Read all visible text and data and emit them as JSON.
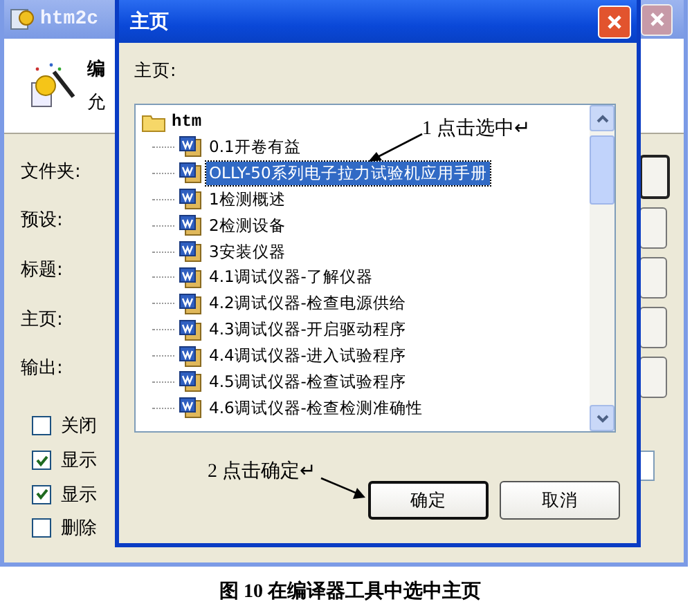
{
  "background_window": {
    "title": "htm2c",
    "header_title": "编",
    "header_subtitle": "允",
    "labels": [
      "文件夹:",
      "预设:",
      "标题:",
      "主页:",
      "输出:"
    ],
    "options": [
      {
        "label": "关闭",
        "checked": false
      },
      {
        "label": "显示",
        "checked": true
      },
      {
        "label": "显示",
        "checked": true
      },
      {
        "label": "删除",
        "checked": false
      }
    ]
  },
  "dialog": {
    "title": "主页",
    "label": "主页:",
    "tree": {
      "label": "htm",
      "children": [
        {
          "label": "0.1开卷有益",
          "selected": false
        },
        {
          "label": "OLLY-50系列电子拉力试验机应用手册",
          "selected": true
        },
        {
          "label": "1检测概述",
          "selected": false
        },
        {
          "label": "2检测设备",
          "selected": false
        },
        {
          "label": "3安装仪器",
          "selected": false
        },
        {
          "label": "4.1调试仪器-了解仪器",
          "selected": false
        },
        {
          "label": "4.2调试仪器-检查电源供给",
          "selected": false
        },
        {
          "label": "4.3调试仪器-开启驱动程序",
          "selected": false
        },
        {
          "label": "4.4调试仪器-进入试验程序",
          "selected": false
        },
        {
          "label": "4.5调试仪器-检查试验程序",
          "selected": false
        },
        {
          "label": "4.6调试仪器-检查检测准确性",
          "selected": false
        }
      ]
    },
    "buttons": [
      {
        "label": "确定",
        "default": true
      },
      {
        "label": "取消",
        "default": false
      }
    ]
  },
  "annotations": [
    {
      "text": "1 点击选中↵"
    },
    {
      "text": "2 点击确定↵"
    }
  ],
  "caption": "图 10 在编译器工具中选中主页"
}
